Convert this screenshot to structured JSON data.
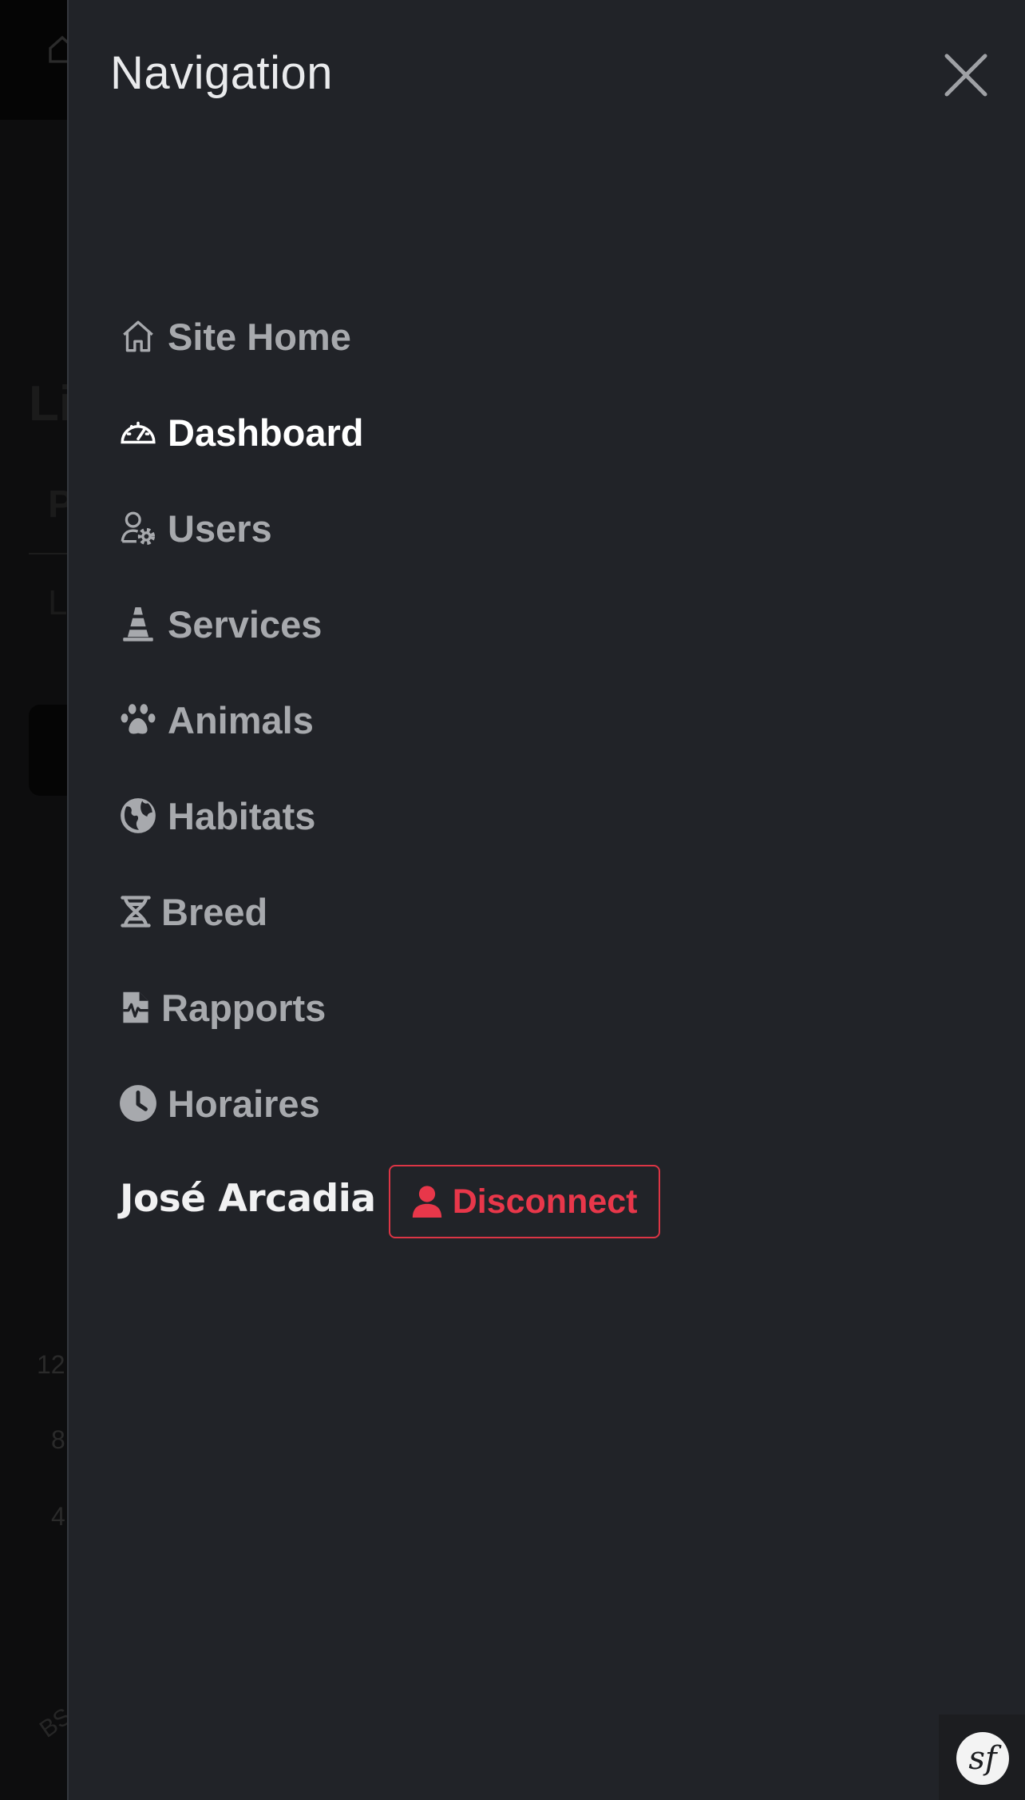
{
  "background": {
    "heading": "Li",
    "subheading": "P",
    "subline": "L",
    "ticks": [
      "12",
      "8",
      "4"
    ],
    "footer": "BS"
  },
  "offcanvas": {
    "title": "Navigation",
    "close_icon": "close-icon",
    "nav_items": [
      {
        "label": "Site Home",
        "icon": "house-icon",
        "active": false
      },
      {
        "label": "Dashboard",
        "icon": "speedometer-icon",
        "active": true
      },
      {
        "label": "Users",
        "icon": "person-gear-icon",
        "active": false
      },
      {
        "label": "Services",
        "icon": "cone-icon",
        "active": false
      },
      {
        "label": "Animals",
        "icon": "paw-icon",
        "active": false
      },
      {
        "label": "Habitats",
        "icon": "globe-icon",
        "active": false
      },
      {
        "label": "Breed",
        "icon": "dna-icon",
        "active": false
      },
      {
        "label": "Rapports",
        "icon": "file-medical-icon",
        "active": false
      },
      {
        "label": "Horaires",
        "icon": "clock-icon",
        "active": false
      }
    ],
    "user": {
      "name": "José Arcadia",
      "disconnect_label": "Disconnect",
      "disconnect_icon": "person-icon"
    }
  },
  "debug_badge": {
    "label": "sf",
    "icon": "symfony-icon"
  },
  "colors": {
    "panel_bg": "#212328",
    "nav_text": "#a7a9ad",
    "active_text": "#ffffff",
    "danger": "#dc3545"
  }
}
